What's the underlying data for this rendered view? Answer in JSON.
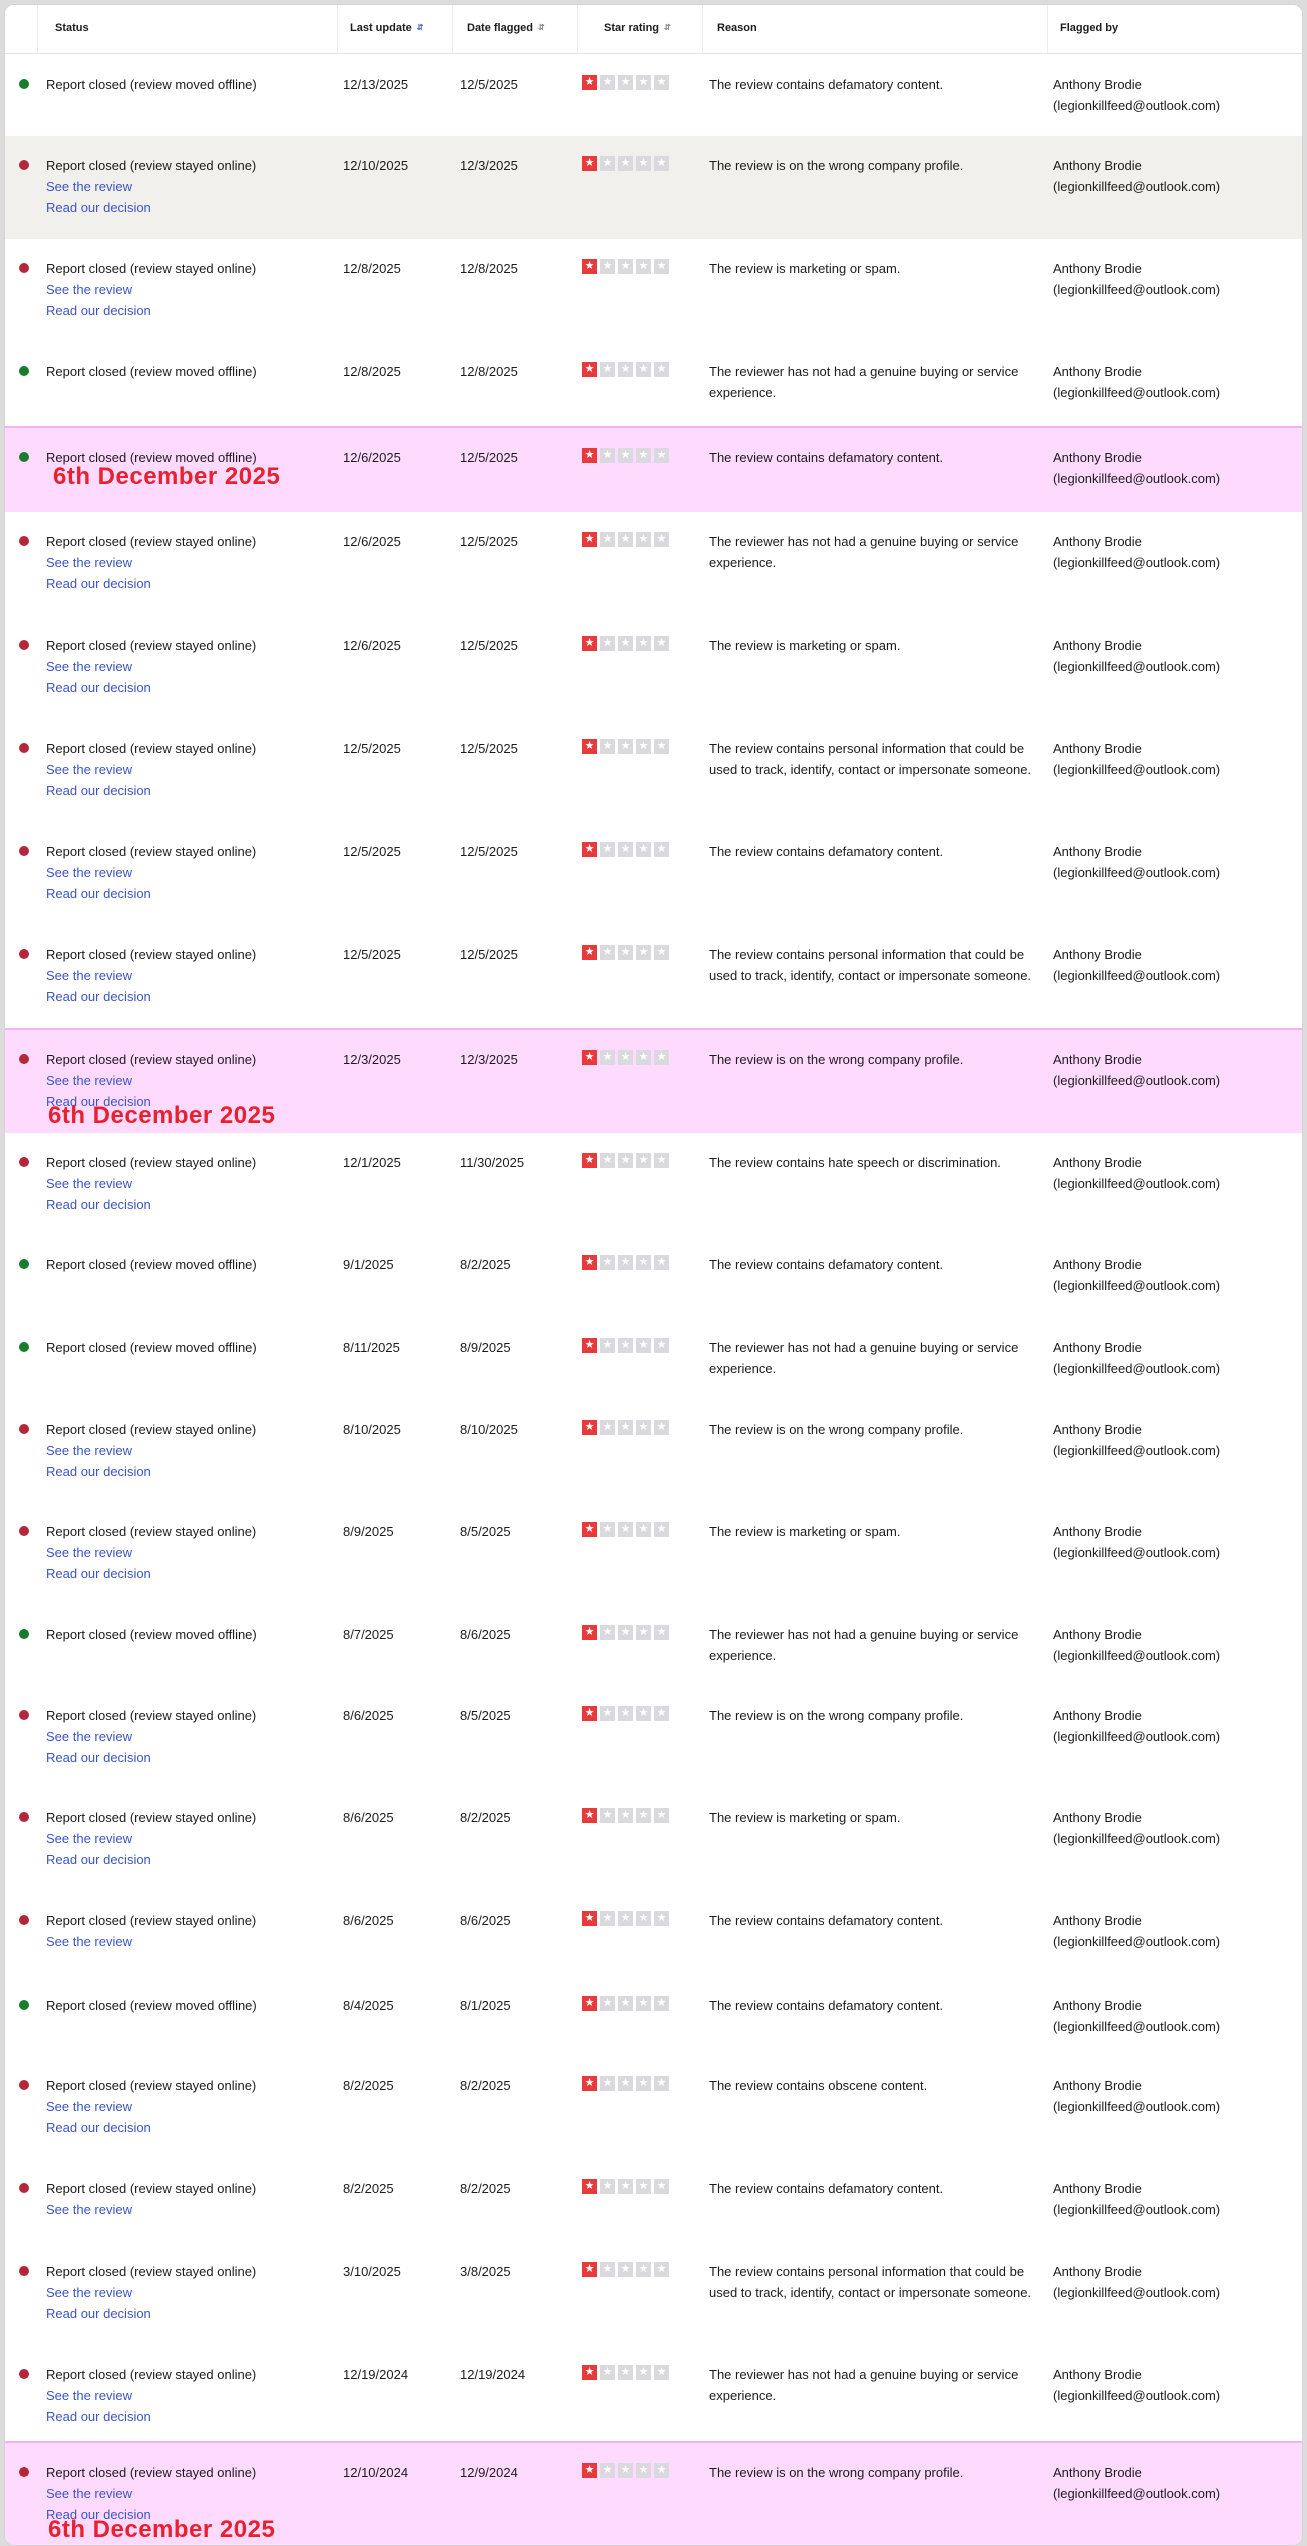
{
  "columns": {
    "status": "Status",
    "last_update": "Last update",
    "date_flagged": "Date flagged",
    "star_rating": "Star rating",
    "reason": "Reason",
    "flagged_by": "Flagged by"
  },
  "sort_icon": "sort-arrows-icon",
  "status_colors": {
    "moved_offline": "#1b7c2b",
    "stayed_online": "#b3273a"
  },
  "link_labels": {
    "see_review": "See the review",
    "read_decision": "Read our decision"
  },
  "star_icon": "star-icon",
  "highlight_color": "#ffdaff",
  "annotation_color": "#e8212f",
  "rows": [
    {
      "status": "Report closed (review moved offline)",
      "state": "moved_offline",
      "last_update": "12/13/2025",
      "date_flagged": "12/5/2025",
      "rating": 1,
      "reason": "The review contains defamatory content.",
      "by_name": "Anthony Brodie",
      "by_email": "(legionkillfeed@outlook.com)",
      "see_review": false,
      "read_decision": false
    },
    {
      "status": "Report closed (review stayed online)",
      "state": "stayed_online",
      "last_update": "12/10/2025",
      "date_flagged": "12/3/2025",
      "rating": 1,
      "reason": "The review is on the wrong company profile.",
      "by_name": "Anthony Brodie",
      "by_email": "(legionkillfeed@outlook.com)",
      "see_review": true,
      "read_decision": true,
      "hover": true
    },
    {
      "status": "Report closed (review stayed online)",
      "state": "stayed_online",
      "last_update": "12/8/2025",
      "date_flagged": "12/8/2025",
      "rating": 1,
      "reason": "The review is marketing or spam.",
      "by_name": "Anthony Brodie",
      "by_email": "(legionkillfeed@outlook.com)",
      "see_review": true,
      "read_decision": true
    },
    {
      "status": "Report closed (review moved offline)",
      "state": "moved_offline",
      "last_update": "12/8/2025",
      "date_flagged": "12/8/2025",
      "rating": 1,
      "reason": "The reviewer has not had a genuine buying or service experience.",
      "by_name": "Anthony Brodie",
      "by_email": "(legionkillfeed@outlook.com)",
      "see_review": false,
      "read_decision": false
    },
    {
      "status": "Report closed (review moved offline)",
      "state": "moved_offline",
      "last_update": "12/6/2025",
      "date_flagged": "12/5/2025",
      "rating": 1,
      "reason": "The review contains defamatory content.",
      "by_name": "Anthony Brodie",
      "by_email": "(legionkillfeed@outlook.com)",
      "see_review": false,
      "read_decision": false,
      "highlight": true,
      "annotation": "6th December 2025"
    },
    {
      "status": "Report closed (review stayed online)",
      "state": "stayed_online",
      "last_update": "12/6/2025",
      "date_flagged": "12/5/2025",
      "rating": 1,
      "reason": "The reviewer has not had a genuine buying or service experience.",
      "by_name": "Anthony Brodie",
      "by_email": "(legionkillfeed@outlook.com)",
      "see_review": true,
      "read_decision": true
    },
    {
      "status": "Report closed (review stayed online)",
      "state": "stayed_online",
      "last_update": "12/6/2025",
      "date_flagged": "12/5/2025",
      "rating": 1,
      "reason": "The review is marketing or spam.",
      "by_name": "Anthony Brodie",
      "by_email": "(legionkillfeed@outlook.com)",
      "see_review": true,
      "read_decision": true
    },
    {
      "status": "Report closed (review stayed online)",
      "state": "stayed_online",
      "last_update": "12/5/2025",
      "date_flagged": "12/5/2025",
      "rating": 1,
      "reason": "The review contains personal information that could be used to track, identify, contact or impersonate someone.",
      "by_name": "Anthony Brodie",
      "by_email": "(legionkillfeed@outlook.com)",
      "see_review": true,
      "read_decision": true
    },
    {
      "status": "Report closed (review stayed online)",
      "state": "stayed_online",
      "last_update": "12/5/2025",
      "date_flagged": "12/5/2025",
      "rating": 1,
      "reason": "The review contains defamatory content.",
      "by_name": "Anthony Brodie",
      "by_email": "(legionkillfeed@outlook.com)",
      "see_review": true,
      "read_decision": true
    },
    {
      "status": "Report closed (review stayed online)",
      "state": "stayed_online",
      "last_update": "12/5/2025",
      "date_flagged": "12/5/2025",
      "rating": 1,
      "reason": "The review contains personal information that could be used to track, identify, contact or impersonate someone.",
      "by_name": "Anthony Brodie",
      "by_email": "(legionkillfeed@outlook.com)",
      "see_review": true,
      "read_decision": true
    },
    {
      "status": "Report closed (review stayed online)",
      "state": "stayed_online",
      "last_update": "12/3/2025",
      "date_flagged": "12/3/2025",
      "rating": 1,
      "reason": "The review is on the wrong company profile.",
      "by_name": "Anthony Brodie",
      "by_email": "(legionkillfeed@outlook.com)",
      "see_review": true,
      "read_decision": true,
      "highlight": true,
      "annotation": "6th December 2025"
    },
    {
      "status": "Report closed (review stayed online)",
      "state": "stayed_online",
      "last_update": "12/1/2025",
      "date_flagged": "11/30/2025",
      "rating": 1,
      "reason": "The review contains hate speech or discrimination.",
      "by_name": "Anthony Brodie",
      "by_email": "(legionkillfeed@outlook.com)",
      "see_review": true,
      "read_decision": true
    },
    {
      "status": "Report closed (review moved offline)",
      "state": "moved_offline",
      "last_update": "9/1/2025",
      "date_flagged": "8/2/2025",
      "rating": 1,
      "reason": "The review contains defamatory content.",
      "by_name": "Anthony Brodie",
      "by_email": "(legionkillfeed@outlook.com)",
      "see_review": false,
      "read_decision": false
    },
    {
      "status": "Report closed (review moved offline)",
      "state": "moved_offline",
      "last_update": "8/11/2025",
      "date_flagged": "8/9/2025",
      "rating": 1,
      "reason": "The reviewer has not had a genuine buying or service experience.",
      "by_name": "Anthony Brodie",
      "by_email": "(legionkillfeed@outlook.com)",
      "see_review": false,
      "read_decision": false
    },
    {
      "status": "Report closed (review stayed online)",
      "state": "stayed_online",
      "last_update": "8/10/2025",
      "date_flagged": "8/10/2025",
      "rating": 1,
      "reason": "The review is on the wrong company profile.",
      "by_name": "Anthony Brodie",
      "by_email": "(legionkillfeed@outlook.com)",
      "see_review": true,
      "read_decision": true
    },
    {
      "status": "Report closed (review stayed online)",
      "state": "stayed_online",
      "last_update": "8/9/2025",
      "date_flagged": "8/5/2025",
      "rating": 1,
      "reason": "The review is marketing or spam.",
      "by_name": "Anthony Brodie",
      "by_email": "(legionkillfeed@outlook.com)",
      "see_review": true,
      "read_decision": true
    },
    {
      "status": "Report closed (review moved offline)",
      "state": "moved_offline",
      "last_update": "8/7/2025",
      "date_flagged": "8/6/2025",
      "rating": 1,
      "reason": "The reviewer has not had a genuine buying or service experience.",
      "by_name": "Anthony Brodie",
      "by_email": "(legionkillfeed@outlook.com)",
      "see_review": false,
      "read_decision": false
    },
    {
      "status": "Report closed (review stayed online)",
      "state": "stayed_online",
      "last_update": "8/6/2025",
      "date_flagged": "8/5/2025",
      "rating": 1,
      "reason": "The review is on the wrong company profile.",
      "by_name": "Anthony Brodie",
      "by_email": "(legionkillfeed@outlook.com)",
      "see_review": true,
      "read_decision": true
    },
    {
      "status": "Report closed (review stayed online)",
      "state": "stayed_online",
      "last_update": "8/6/2025",
      "date_flagged": "8/2/2025",
      "rating": 1,
      "reason": "The review is marketing or spam.",
      "by_name": "Anthony Brodie",
      "by_email": "(legionkillfeed@outlook.com)",
      "see_review": true,
      "read_decision": true
    },
    {
      "status": "Report closed (review stayed online)",
      "state": "stayed_online",
      "last_update": "8/6/2025",
      "date_flagged": "8/6/2025",
      "rating": 1,
      "reason": "The review contains defamatory content.",
      "by_name": "Anthony Brodie",
      "by_email": "(legionkillfeed@outlook.com)",
      "see_review": true,
      "read_decision": false
    },
    {
      "status": "Report closed (review moved offline)",
      "state": "moved_offline",
      "last_update": "8/4/2025",
      "date_flagged": "8/1/2025",
      "rating": 1,
      "reason": "The review contains defamatory content.",
      "by_name": "Anthony Brodie",
      "by_email": "(legionkillfeed@outlook.com)",
      "see_review": false,
      "read_decision": false
    },
    {
      "status": "Report closed (review stayed online)",
      "state": "stayed_online",
      "last_update": "8/2/2025",
      "date_flagged": "8/2/2025",
      "rating": 1,
      "reason": "The review contains obscene content.",
      "by_name": "Anthony Brodie",
      "by_email": "(legionkillfeed@outlook.com)",
      "see_review": true,
      "read_decision": true
    },
    {
      "status": "Report closed (review stayed online)",
      "state": "stayed_online",
      "last_update": "8/2/2025",
      "date_flagged": "8/2/2025",
      "rating": 1,
      "reason": "The review contains defamatory content.",
      "by_name": "Anthony Brodie",
      "by_email": "(legionkillfeed@outlook.com)",
      "see_review": true,
      "read_decision": false
    },
    {
      "status": "Report closed (review stayed online)",
      "state": "stayed_online",
      "last_update": "3/10/2025",
      "date_flagged": "3/8/2025",
      "rating": 1,
      "reason": "The review contains personal information that could be used to track, identify, contact or impersonate someone.",
      "by_name": "Anthony Brodie",
      "by_email": "(legionkillfeed@outlook.com)",
      "see_review": true,
      "read_decision": true
    },
    {
      "status": "Report closed (review stayed online)",
      "state": "stayed_online",
      "last_update": "12/19/2024",
      "date_flagged": "12/19/2024",
      "rating": 1,
      "reason": "The reviewer has not had a genuine buying or service experience.",
      "by_name": "Anthony Brodie",
      "by_email": "(legionkillfeed@outlook.com)",
      "see_review": true,
      "read_decision": true
    },
    {
      "status": "Report closed (review stayed online)",
      "state": "stayed_online",
      "last_update": "12/10/2024",
      "date_flagged": "12/9/2024",
      "rating": 1,
      "reason": "The review is on the wrong company profile.",
      "by_name": "Anthony Brodie",
      "by_email": "(legionkillfeed@outlook.com)",
      "see_review": true,
      "read_decision": true,
      "highlight": true,
      "annotation": "6th December 2025"
    }
  ]
}
